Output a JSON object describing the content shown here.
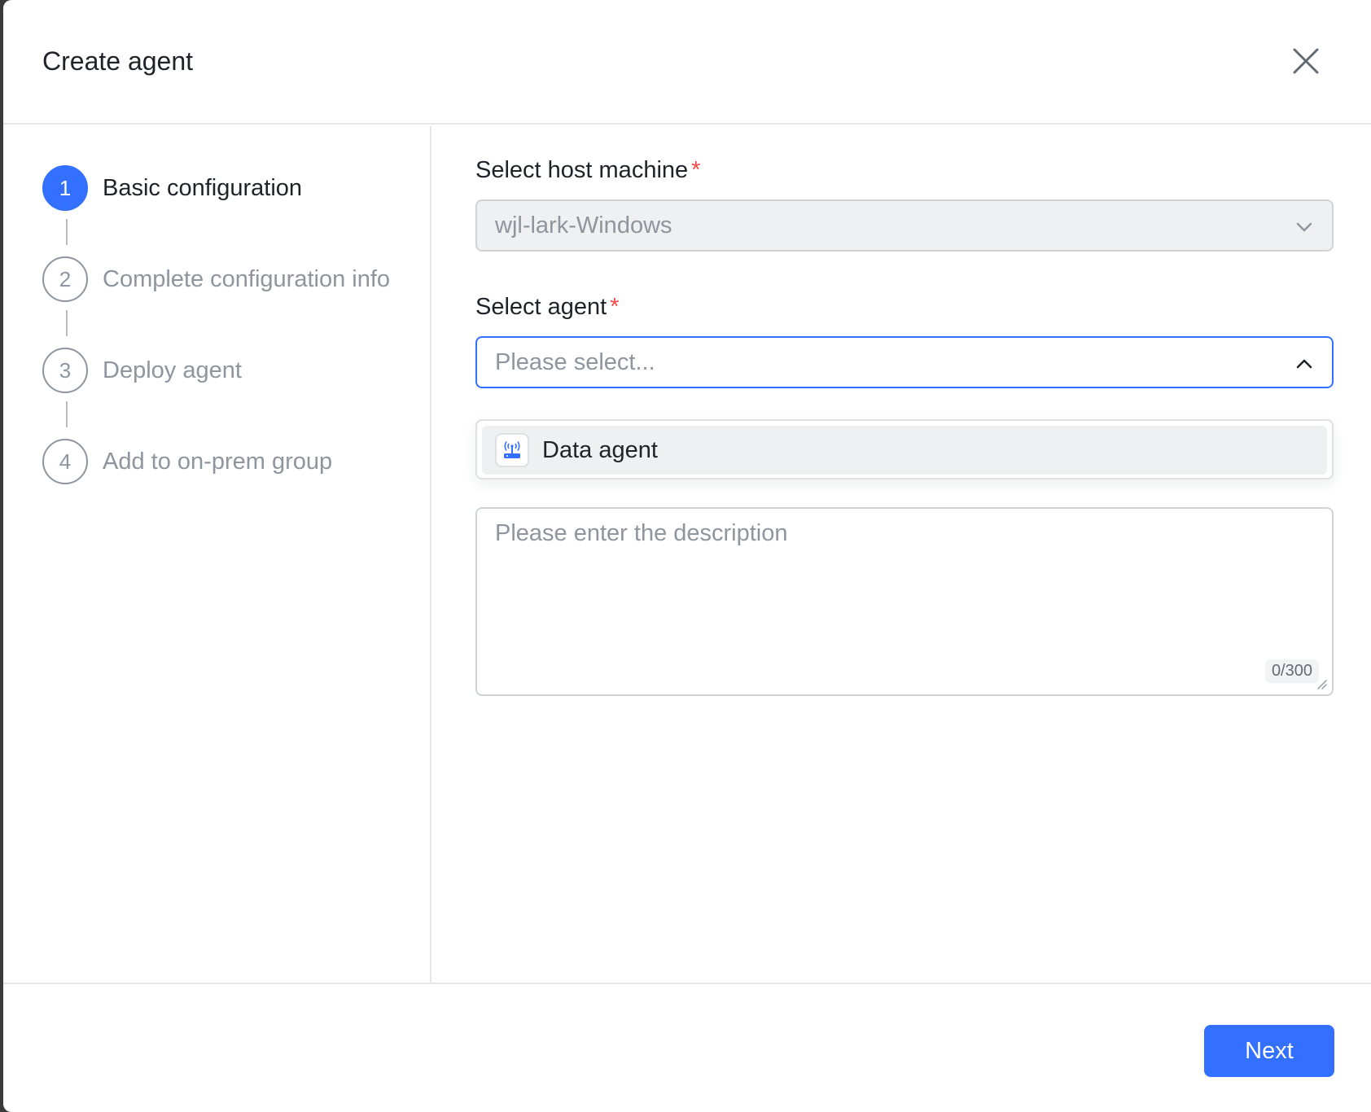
{
  "dialog": {
    "title": "Create agent"
  },
  "steps": [
    {
      "number": "1",
      "label": "Basic configuration",
      "active": true
    },
    {
      "number": "2",
      "label": "Complete configuration info",
      "active": false
    },
    {
      "number": "3",
      "label": "Deploy agent",
      "active": false
    },
    {
      "number": "4",
      "label": "Add to on-prem group",
      "active": false
    }
  ],
  "form": {
    "host_machine": {
      "label": "Select host machine",
      "required_mark": "*",
      "value": "wjl-lark-Windows"
    },
    "agent": {
      "label": "Select agent",
      "required_mark": "*",
      "placeholder": "Please select...",
      "options": [
        {
          "label": "Data agent",
          "icon": "router-antenna-icon"
        }
      ]
    },
    "description": {
      "placeholder": "Please enter the description",
      "counter": "0/300"
    }
  },
  "footer": {
    "next_label": "Next"
  },
  "colors": {
    "primary": "#3370ff",
    "required": "#f54a45",
    "text": "#1f2329",
    "muted": "#8f959e"
  }
}
